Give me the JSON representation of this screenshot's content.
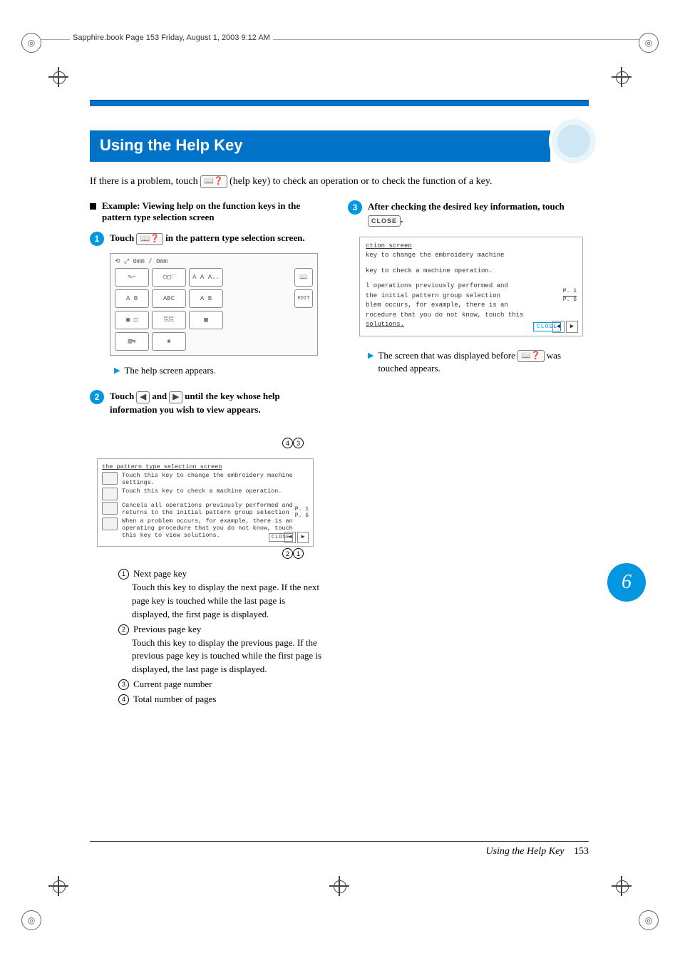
{
  "header_strip": "Sapphire.book  Page 153  Friday, August 1, 2003  9:12 AM",
  "title": "Using the Help Key",
  "intro_pre": "If there is a problem, touch ",
  "intro_key": "📖❓",
  "intro_post": " (help key) to check an operation or to check the function of a key.",
  "example_header": "Example: Viewing help on the function keys in the pattern type selection screen",
  "step1_pre": "Touch ",
  "step1_key": "📖❓",
  "step1_post": " in the pattern type selection screen.",
  "note1": "The help screen appears.",
  "step2_pre": "Touch ",
  "step2_and": " and ",
  "step2_post": " until the key whose help information you wish to view appears.",
  "screenshot1": {
    "coord_line": "⟲  ⤢   0mm / 0mm",
    "row1": [
      "✎✂",
      "◯▢♡",
      "A A A..",
      "📖"
    ],
    "row2": [
      "A B",
      "ABC",
      "A B",
      "EDIT"
    ],
    "row3": [
      "▣ ▢",
      "⎘⎘",
      "▦"
    ],
    "row4": [
      "▥⇆",
      "❀"
    ]
  },
  "help_screen": {
    "title": "the pattern type selection screen",
    "l1": "Touch this key to change the embroidery machine settings.",
    "l2": "Touch this key to check a machine operation.",
    "l3": "Cancels all operations previously performed and returns to the initial pattern group selection",
    "l4": "When a problem occurs, for example, there is an operating procedure that you do not know, touch this key to view solutions.",
    "page_cur": "P. 1",
    "page_total": "P. 6",
    "close": "CLOSE"
  },
  "legend": {
    "1": {
      "t": "Next page key",
      "d": "Touch this key to display the next page. If the next page key is touched while the last page is displayed, the first page is displayed."
    },
    "2": {
      "t": "Previous page key",
      "d": "Touch this key to display the previous page. If the previous page key is touched while the first page is displayed, the last page is displayed."
    },
    "3": {
      "t": "Current page number"
    },
    "4": {
      "t": "Total number of pages"
    }
  },
  "step3_pre": "After checking the desired key information, touch ",
  "step3_key": "CLOSE",
  "step3_post": ".",
  "r_screen": {
    "h": "ction screen",
    "l1": "key to change the embroidery machine",
    "l2": "key to check a machine operation.",
    "l3": "l operations previously performed and",
    "l4": "the initial pattern group selection",
    "l5": "blem occurs, for example, there is an",
    "l6": "rocedure that you do not know, touch this",
    "l7": " solutions.",
    "page_cur": "P. 1",
    "page_total": "P. 6",
    "close": "CLOSE"
  },
  "note3_pre": "The screen that was displayed before ",
  "note3_key": "📖❓",
  "note3_post": " was touched appears.",
  "chapter": "6",
  "footer_title": "Using the Help Key",
  "footer_page": "153"
}
